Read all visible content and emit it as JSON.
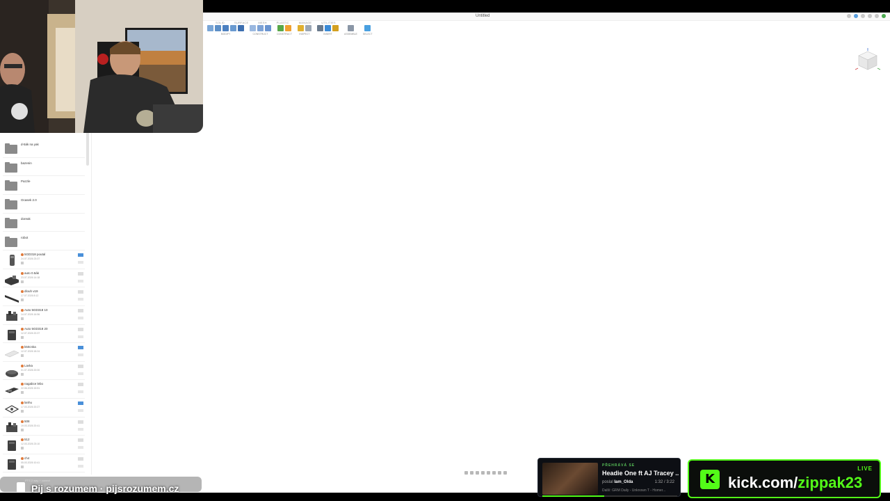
{
  "window": {
    "title": "Untitled"
  },
  "ribbon": {
    "tabs": [
      "SOLID",
      "SURFACE",
      "MESH",
      "PLASTIC",
      "MANAGE",
      "UTILITIES"
    ],
    "groups": [
      {
        "label": "MODIFY",
        "colors": [
          "#7aa6d6",
          "#5c8fc7",
          "#4c80c0",
          "#6a9ad0",
          "#3d6fb0"
        ]
      },
      {
        "label": "CONSTRUCT",
        "colors": [
          "#9ab8e0",
          "#7ea3d6",
          "#6a94d0"
        ]
      },
      {
        "label": "CONSTRUCT",
        "colors": [
          "#58a848",
          "#f0a030"
        ]
      },
      {
        "label": "INSPECT",
        "colors": [
          "#e0b030",
          "#9aa6b4"
        ]
      },
      {
        "label": "INSERT",
        "colors": [
          "#6a7a8c",
          "#3a8ad6",
          "#d4a020"
        ]
      },
      {
        "label": "ASSEMBLE",
        "colors": [
          "#8a96a6"
        ]
      },
      {
        "label": "SELECT",
        "colors": [
          "#4aa0e0"
        ]
      }
    ]
  },
  "panel": {
    "folders": [
      "d-5ák na yak",
      "bazenin",
      "Pazzle",
      "Ocasek 2.0",
      "doreak",
      "robot"
    ],
    "files": [
      {
        "name": "5GD318 poutal",
        "date": "24.07.2026 23:37",
        "thumb": "cylinder",
        "badge": "blue"
      },
      {
        "name": "auto 0.5ák",
        "date": "23.07.2026 14:18",
        "thumb": "bracket",
        "badge": "grey"
      },
      {
        "name": "dlouh v19",
        "date": "17.07.2026 8:12",
        "thumb": "bar",
        "badge": "grey"
      },
      {
        "name": "Auto 5GD318 10",
        "date": "14.07.2026 16:56",
        "thumb": "machine",
        "badge": "grey"
      },
      {
        "name": "Auto 5GD318 20",
        "date": "12.07.2026 20:37",
        "thumb": "block",
        "badge": "grey"
      },
      {
        "name": "k50cnka",
        "date": "12.07.2026 18:24",
        "thumb": "sheet",
        "badge": "blue"
      },
      {
        "name": "Lavka",
        "date": "01.07.2026 20:00",
        "thumb": "round",
        "badge": "grey"
      },
      {
        "name": "nagabce lebo",
        "date": "22.06.2026 15:51",
        "thumb": "wide",
        "badge": "grey"
      },
      {
        "name": "lanhu",
        "date": "17.03.2026 20:27",
        "thumb": "frame",
        "badge": "blue"
      },
      {
        "name": "508",
        "date": "19.03.2026 20:41",
        "thumb": "machine",
        "badge": "grey"
      },
      {
        "name": "512",
        "date": "12.03.2026 23:10",
        "thumb": "block",
        "badge": "grey"
      },
      {
        "name": "ch4",
        "date": "05.03.2026 10:41",
        "thumb": "block",
        "badge": "grey"
      }
    ],
    "footer": "PTS 2 way + conect"
  },
  "overlays": {
    "bottom_text": "Pij s rozumem · pijsrozumem.cz",
    "music": {
      "label": "PŘEHRÁVÁ SE",
      "title": "Headie One ft AJ Tracey ...",
      "posted_by_prefix": "poslal",
      "posted_by": "Iam_Olda",
      "time": "1:32 / 3:22",
      "next": "Další: GRM Daily - Unknown T - Homer...",
      "progress": 0.46
    },
    "kick": {
      "live": "LIVE",
      "url_prefix": "kick.com/",
      "url_user": "zippak23",
      "logo": "K"
    }
  }
}
